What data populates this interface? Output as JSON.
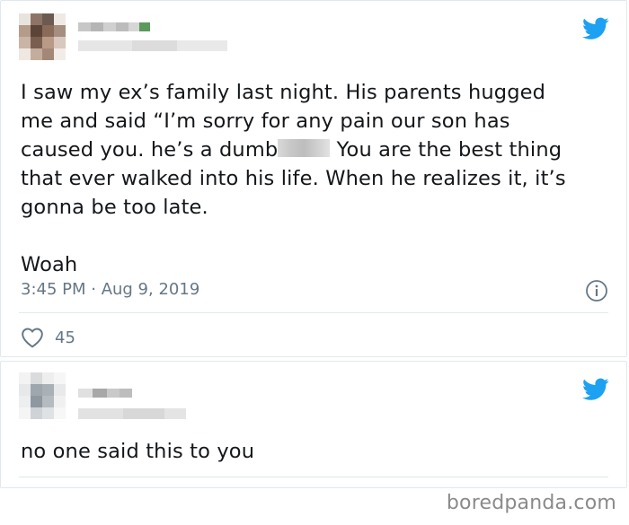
{
  "tweets": [
    {
      "text_part1": "I saw my ex’s family last night. His parents hugged\nme and said “I’m sorry for any pain our son has\ncaused you. he’s a dumb",
      "text_part2": " You are the best thing\nthat ever walked into his life. When he realizes it, it’s\ngonna be too late.\n\nWoah",
      "timestamp": "3:45 PM · Aug 9, 2019",
      "like_count": "45"
    },
    {
      "text": "no one said this to you"
    }
  ],
  "watermark": "boredpanda.com",
  "colors": {
    "twitter_blue": "#1da1f2",
    "meta_gray": "#657786",
    "border": "#e1e8ed"
  },
  "icons": [
    "twitter-bird-icon",
    "info-icon",
    "heart-icon"
  ]
}
